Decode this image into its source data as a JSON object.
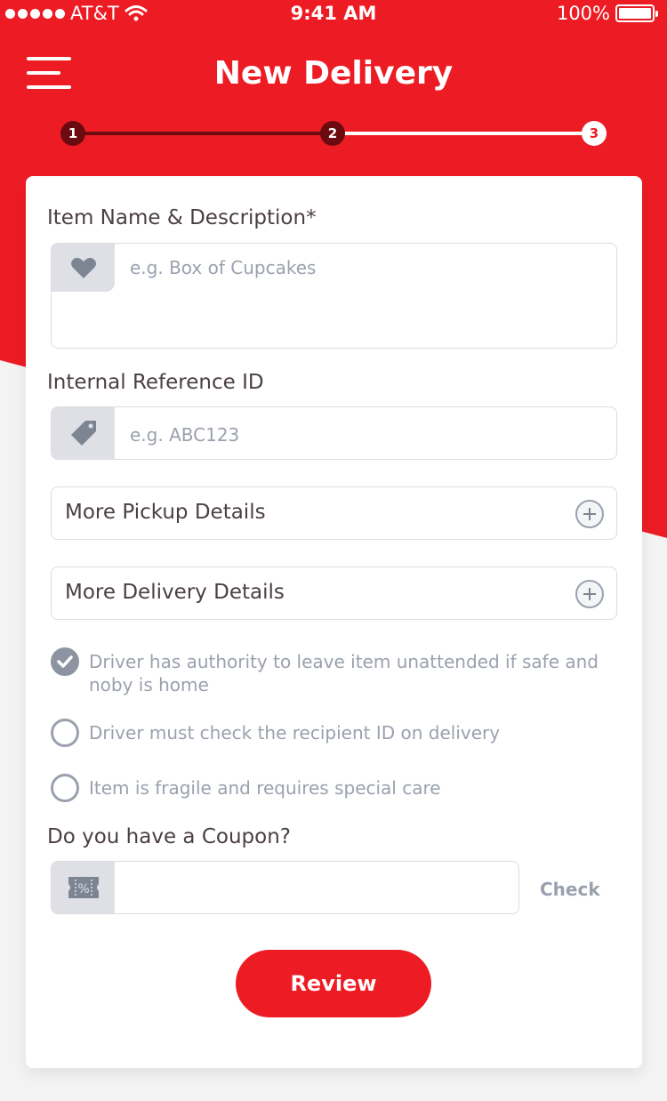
{
  "status_bar": {
    "carrier": "AT&T",
    "time": "9:41 AM",
    "battery": "100%"
  },
  "header": {
    "title": "New Delivery"
  },
  "stepper": {
    "steps": [
      "1",
      "2",
      "3"
    ],
    "current_step": 3
  },
  "form": {
    "item_label": "Item Name & Description*",
    "item_placeholder": "e.g. Box of Cupcakes",
    "ref_label": "Internal Reference ID",
    "ref_placeholder": "e.g. ABC123",
    "pickup_details": "More Pickup Details",
    "delivery_details": "More Delivery Details",
    "options": [
      {
        "label": "Driver has authority to leave item unattended if safe and noby is home",
        "checked": true
      },
      {
        "label": "Driver must check the recipient ID on delivery",
        "checked": false
      },
      {
        "label": "Item is fragile and requires special care",
        "checked": false
      }
    ],
    "coupon_label": "Do you have a Coupon?",
    "coupon_value": "",
    "check_label": "Check",
    "review_label": "Review"
  },
  "icons": {
    "item": "heart-icon",
    "reference": "tag-icon",
    "coupon": "coupon-ticket-icon",
    "expand": "plus-circle-icon"
  },
  "colors": {
    "brand": "#ed1c24",
    "step_done": "#6b0b10",
    "muted": "#9aa1ae"
  }
}
